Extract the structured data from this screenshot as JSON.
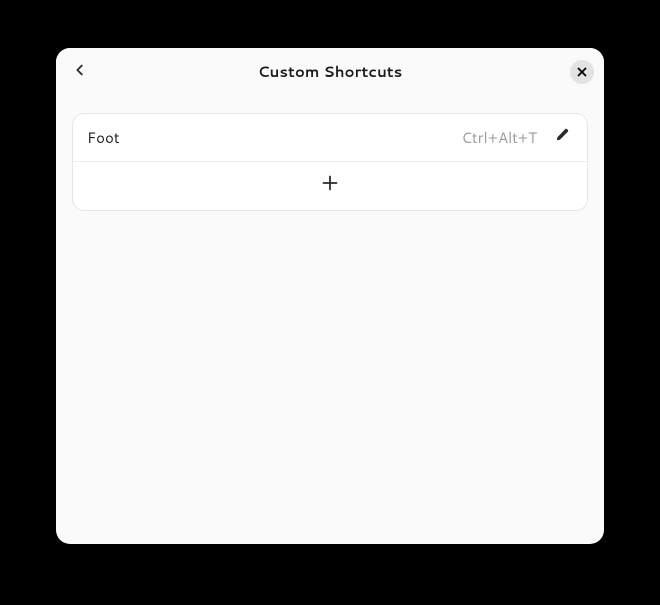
{
  "header": {
    "title": "Custom Shortcuts"
  },
  "shortcuts": [
    {
      "name": "Foot",
      "keys": "Ctrl+Alt+T"
    }
  ],
  "icons": {
    "back": "chevron-left-icon",
    "close": "close-icon",
    "edit": "pencil-icon",
    "add": "plus-icon"
  }
}
